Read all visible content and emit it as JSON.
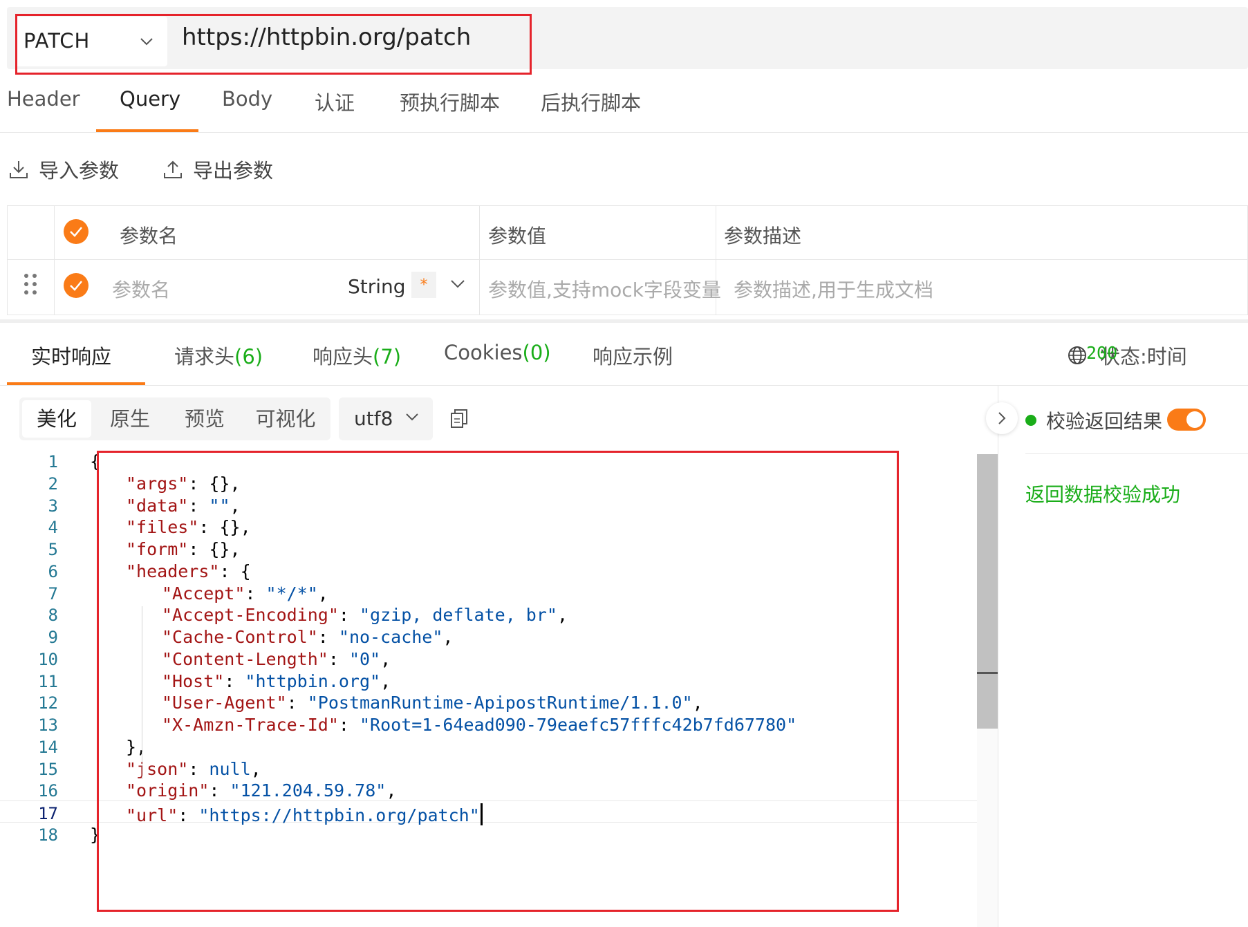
{
  "request": {
    "method": "PATCH",
    "url": "https://httpbin.org/patch"
  },
  "request_tabs": [
    {
      "label": "Header"
    },
    {
      "label": "Query",
      "active": true
    },
    {
      "label": "Body"
    },
    {
      "label": "认证"
    },
    {
      "label": "预执行脚本"
    },
    {
      "label": "后执行脚本"
    }
  ],
  "params_toolbar": {
    "import_label": "导入参数",
    "export_label": "导出参数"
  },
  "params_table": {
    "headers": {
      "name": "参数名",
      "value": "参数值",
      "desc": "参数描述"
    },
    "row": {
      "name_placeholder": "参数名",
      "type": "String",
      "required_mark": "*",
      "value_placeholder": "参数值,支持mock字段变量",
      "desc_placeholder": "参数描述,用于生成文档"
    }
  },
  "response_tabs": {
    "realtime": "实时响应",
    "req_headers": "请求头",
    "req_headers_count": "(6)",
    "resp_headers": "响应头",
    "resp_headers_count": "(7)",
    "cookies": "Cookies",
    "cookies_count": "(0)",
    "examples": "响应示例"
  },
  "status": {
    "label": "状态:",
    "code": "200",
    "time_label": "时间"
  },
  "view_modes": [
    "美化",
    "原生",
    "预览",
    "可视化"
  ],
  "encoding": "utf8",
  "validation": {
    "label": "校验返回结果",
    "enabled": true,
    "message": "返回数据校验成功"
  },
  "response_body": {
    "current_line": 17,
    "lines": [
      {
        "n": "1",
        "t": "{"
      },
      {
        "n": "2",
        "k": "\"args\"",
        "p": ": {},"
      },
      {
        "n": "3",
        "k": "\"data\"",
        "p": ": ",
        "v": "\"\"",
        "s": ","
      },
      {
        "n": "4",
        "k": "\"files\"",
        "p": ": {},"
      },
      {
        "n": "5",
        "k": "\"form\"",
        "p": ": {},"
      },
      {
        "n": "6",
        "k": "\"headers\"",
        "p": ": {"
      },
      {
        "n": "7",
        "k": "\"Accept\"",
        "p": ": ",
        "v": "\"*/*\"",
        "s": ","
      },
      {
        "n": "8",
        "k": "\"Accept-Encoding\"",
        "p": ": ",
        "v": "\"gzip, deflate, br\"",
        "s": ","
      },
      {
        "n": "9",
        "k": "\"Cache-Control\"",
        "p": ": ",
        "v": "\"no-cache\"",
        "s": ","
      },
      {
        "n": "10",
        "k": "\"Content-Length\"",
        "p": ": ",
        "v": "\"0\"",
        "s": ","
      },
      {
        "n": "11",
        "k": "\"Host\"",
        "p": ": ",
        "v": "\"httpbin.org\"",
        "s": ","
      },
      {
        "n": "12",
        "k": "\"User-Agent\"",
        "p": ": ",
        "v": "\"PostmanRuntime-ApipostRuntime/1.1.0\"",
        "s": ","
      },
      {
        "n": "13",
        "k": "\"X-Amzn-Trace-Id\"",
        "p": ": ",
        "v": "\"Root=1-64ead090-79eaefc57fffc42b7fd67780\""
      },
      {
        "n": "14",
        "t": "},"
      },
      {
        "n": "15",
        "k": "\"json\"",
        "p": ": ",
        "v": "null",
        "s": ","
      },
      {
        "n": "16",
        "k": "\"origin\"",
        "p": ": ",
        "v": "\"121.204.59.78\"",
        "s": ","
      },
      {
        "n": "17",
        "k": "\"url\"",
        "p": ": ",
        "v": "\"https://httpbin.org/patch\""
      },
      {
        "n": "18",
        "t": "}"
      }
    ]
  },
  "colors": {
    "accent": "#fa7b17",
    "success": "#1aad19",
    "highlight_box": "#e5232b",
    "json_key": "#a31515",
    "json_value": "#0451a5"
  }
}
